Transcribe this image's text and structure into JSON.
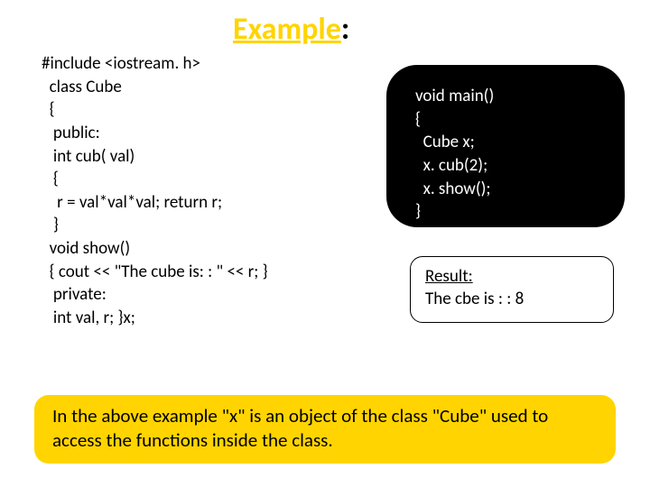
{
  "title": {
    "word": "Example",
    "colon": ":"
  },
  "code_left": "#include <iostream. h>\n  class Cube\n  {\n   public:\n   int cub( val)\n   {\n    r = val*val*val; return r;\n   }\n  void show()\n  { cout << \"The cube is: : \" << r; }\n   private:\n   int val, r; }x;",
  "code_main": "void main()\n{\n  Cube x;\n  x. cub(2);\n  x. show();\n}",
  "result": {
    "label": "Result:",
    "text": "The cbe is : : 8"
  },
  "footer": "In the above example \"x\" is an object of the class \"Cube\"\n used to access the functions inside the class."
}
